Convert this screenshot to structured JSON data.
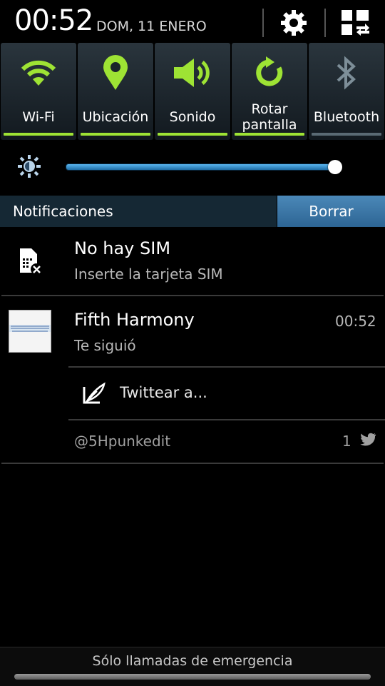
{
  "status": {
    "time": "00:52",
    "date": "DOM, 11 ENERO"
  },
  "colors": {
    "accent_green": "#9ee334",
    "accent_blue": "#3a8fd0",
    "bluetooth_gray": "#7d8e98"
  },
  "toggles": [
    {
      "label": "Wi-Fi",
      "icon": "wifi-icon",
      "active": true
    },
    {
      "label": "Ubicación",
      "icon": "location-icon",
      "active": true
    },
    {
      "label": "Sonido",
      "icon": "sound-icon",
      "active": true
    },
    {
      "label": "Rotar\npantalla",
      "icon": "rotate-icon",
      "active": true
    },
    {
      "label": "Bluetooth",
      "icon": "bluetooth-icon",
      "active": false
    }
  ],
  "brightness": {
    "level_percent": 100,
    "icon": "brightness-icon"
  },
  "notifications": {
    "header": "Notificaciones",
    "clear_label": "Borrar",
    "items": [
      {
        "title": "No hay SIM",
        "subtitle": "Inserte la tarjeta SIM",
        "icon": "no-sim-icon"
      },
      {
        "title": "Fifth Harmony",
        "subtitle": "Te siguió",
        "time": "00:52",
        "action_label": "Twittear a...",
        "account": "@5Hpunkedit",
        "count": "1",
        "icon": "twitter-bird-icon"
      }
    ]
  },
  "footer": {
    "emergency": "Sólo llamadas de emergencia"
  }
}
